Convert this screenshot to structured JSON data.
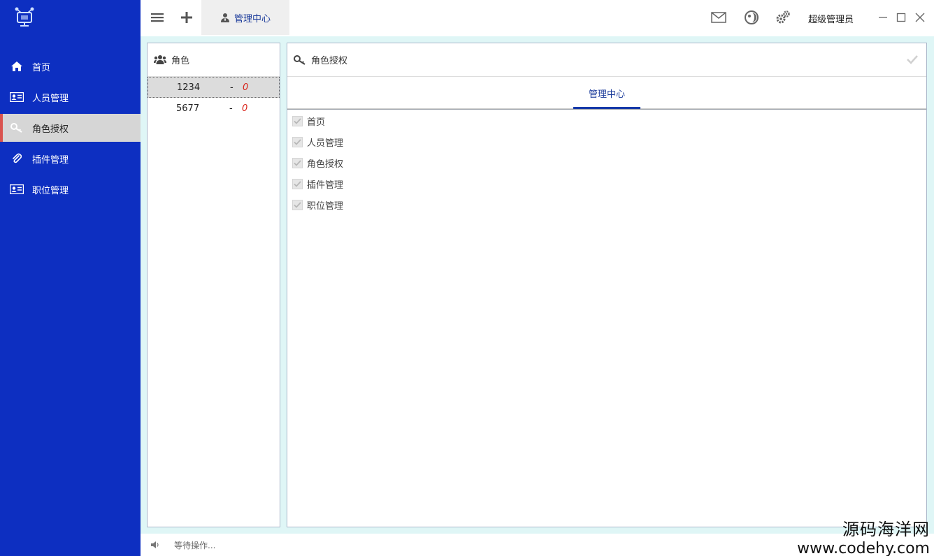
{
  "sidebar": {
    "logo_icon": "monitor-network-icon",
    "items": [
      {
        "label": "首页",
        "icon": "home-icon"
      },
      {
        "label": "人员管理",
        "icon": "id-card-icon"
      },
      {
        "label": "角色授权",
        "icon": "key-icon",
        "active": true
      },
      {
        "label": "插件管理",
        "icon": "paperclip-icon"
      },
      {
        "label": "职位管理",
        "icon": "id-card-icon"
      }
    ],
    "accent_color": "#0d2fc1",
    "active_marker_color": "#d9534f"
  },
  "topbar": {
    "menu_icon": "hamburger-icon",
    "add_icon": "plus-icon",
    "active_tab": "管理中心",
    "active_tab_icon": "user-tie-icon",
    "right_icons": [
      "mail-icon",
      "theme-icon",
      "gears-icon"
    ],
    "user_name": "超级管理员",
    "window_controls": [
      "minimize-icon",
      "maximize-icon",
      "close-icon"
    ]
  },
  "roles_panel": {
    "title": "角色",
    "icon": "users-icon",
    "rows": [
      {
        "id": "1234",
        "sep": "-",
        "count": "0",
        "selected": true
      },
      {
        "id": "5677",
        "sep": "-",
        "count": "0",
        "selected": false
      }
    ]
  },
  "auth_panel": {
    "title": "角色授权",
    "icon": "key-icon",
    "confirm_icon": "check-icon",
    "tab": "管理中心",
    "permissions": [
      {
        "label": "首页",
        "checked": true
      },
      {
        "label": "人员管理",
        "checked": true
      },
      {
        "label": "角色授权",
        "checked": true
      },
      {
        "label": "插件管理",
        "checked": true
      },
      {
        "label": "职位管理",
        "checked": true
      }
    ]
  },
  "status": {
    "icon": "speaker-icon",
    "text": "等待操作..."
  },
  "watermark": {
    "line1": "源码海洋网",
    "line2": "www.codehy.com"
  }
}
